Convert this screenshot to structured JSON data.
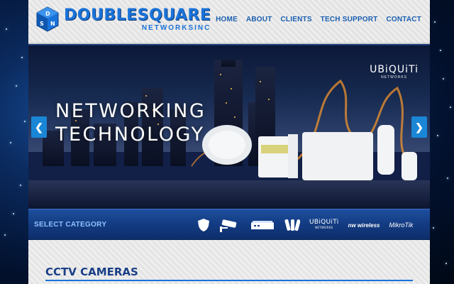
{
  "brand": {
    "name": "DOUBLESQUARE",
    "sub": "NETWORKSINC",
    "mark_letters": [
      "D",
      "S",
      "N"
    ]
  },
  "nav": {
    "items": [
      {
        "label": "HOME"
      },
      {
        "label": "ABOUT"
      },
      {
        "label": "CLIENTS"
      },
      {
        "label": "TECH SUPPORT"
      },
      {
        "label": "CONTACT"
      }
    ]
  },
  "hero": {
    "title_line1": "NETWORKING",
    "title_line2": "TECHNOLOGY",
    "partner_logo": "UBiQUiTi",
    "partner_logo_sub": "NETWORKS",
    "prev_icon": "chevron-left-icon",
    "next_icon": "chevron-right-icon"
  },
  "category_bar": {
    "label": "SELECT CATEGORY",
    "icons": [
      "shield-icon",
      "cctv-camera-icon",
      "network-switch-icon",
      "antenna-icon"
    ],
    "brands": {
      "ubiquiti": "UBiQUiTi",
      "ubiquiti_sub": "NETWORKS",
      "nw": "nw wireless",
      "mikrotik": "MikroTik"
    }
  },
  "section": {
    "title": "CCTV CAMERAS"
  },
  "colors": {
    "brand_blue": "#1a73d9",
    "nav_blue": "#1b5fb0",
    "category_bar": "#133b82",
    "arrow_blue": "#1a86d6"
  }
}
